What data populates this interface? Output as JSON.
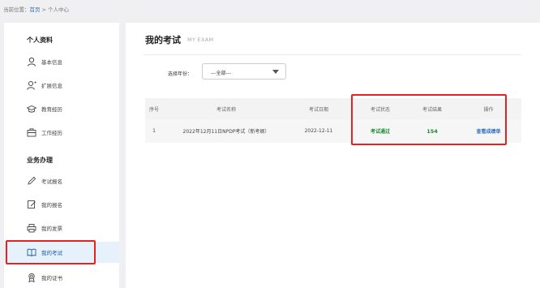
{
  "breadcrumb": {
    "prefix": "当前位置：",
    "home": "首页",
    "separator": ">",
    "current": "个人中心"
  },
  "sidebar": {
    "section_profile": "个人资料",
    "profile_items": [
      {
        "label": "基本信息",
        "icon": "user-icon"
      },
      {
        "label": "扩展信息",
        "icon": "user-plus-icon"
      },
      {
        "label": "教育经历",
        "icon": "graduation-cap-icon"
      },
      {
        "label": "工作经历",
        "icon": "briefcase-icon"
      }
    ],
    "section_business": "业务办理",
    "business_items": [
      {
        "label": "考试报名",
        "icon": "pencil-icon"
      },
      {
        "label": "我的报名",
        "icon": "edit-doc-icon"
      },
      {
        "label": "我的发票",
        "icon": "printer-icon"
      },
      {
        "label": "我的考试",
        "icon": "book-icon",
        "active": true
      },
      {
        "label": "我的证书",
        "icon": "certificate-icon"
      }
    ]
  },
  "main": {
    "title": "我的考试",
    "subtitle": "MY EXAM",
    "filter": {
      "label": "选择年份：",
      "selected": "---全部---"
    },
    "table": {
      "headers": [
        "序号",
        "考试名称",
        "考试日期",
        "考试状态",
        "考试结果",
        "操作"
      ],
      "rows": [
        {
          "index": "1",
          "name": "2022年12月11日NPDP考试（新考纲）",
          "date": "2022-12-11",
          "status": "考试通过",
          "result": "154",
          "action": "查看成绩单"
        }
      ]
    }
  },
  "colors": {
    "highlight": "#e02424",
    "pass_green": "#1d8a32",
    "link_blue": "#2f6fbf",
    "active_bg": "#e7f1fb"
  }
}
